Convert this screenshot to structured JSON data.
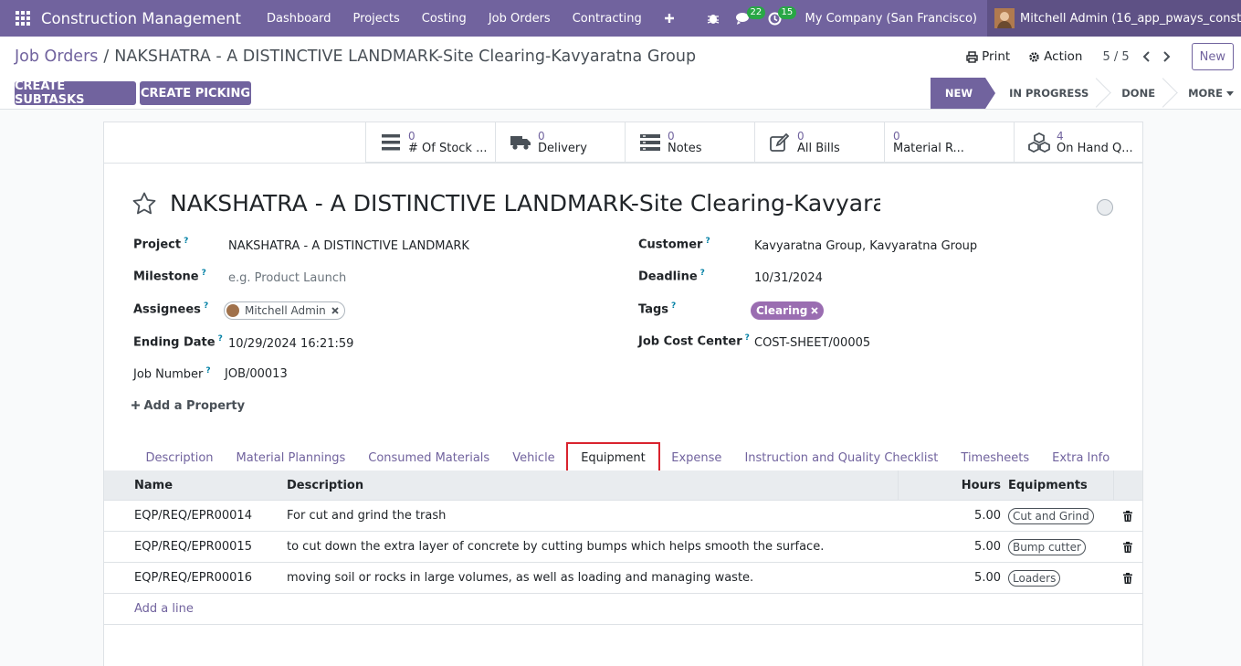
{
  "navbar": {
    "brand": "Construction Management",
    "menu": [
      "Dashboard",
      "Projects",
      "Costing",
      "Job Orders",
      "Contracting"
    ],
    "messages_count": "22",
    "activities_count": "15",
    "company": "My Company (San Francisco)",
    "user": "Mitchell Admin (16_app_pways_const..."
  },
  "control": {
    "breadcrumb_parent": "Job Orders",
    "breadcrumb_sep": "/",
    "breadcrumb_current": "NAKSHATRA - A DISTINCTIVE LANDMARK-Site Clearing-Kavyaratna Group",
    "print_label": "Print",
    "action_label": "Action",
    "pager": "5 / 5",
    "new_label": "New",
    "create_subtasks": "CREATE SUBTASKS",
    "create_picking": "CREATE PICKING",
    "stages": [
      "NEW",
      "IN PROGRESS",
      "DONE"
    ],
    "more": "MORE"
  },
  "smart_buttons": [
    {
      "value": "0",
      "label": "# Of Stock ..."
    },
    {
      "value": "0",
      "label": "Delivery"
    },
    {
      "value": "0",
      "label": "Notes"
    },
    {
      "value": "0",
      "label": "All Bills"
    },
    {
      "value": "0",
      "label": "Material R..."
    },
    {
      "value": "4",
      "label": "On Hand Q..."
    }
  ],
  "record": {
    "title": "NAKSHATRA - A DISTINCTIVE LANDMARK-Site Clearing-Kavyaratna Group",
    "project_label": "Project",
    "project": "NAKSHATRA - A DISTINCTIVE LANDMARK",
    "milestone_label": "Milestone",
    "milestone_placeholder": "e.g. Product Launch",
    "assignees_label": "Assignees",
    "assignee": "Mitchell Admin",
    "ending_date_label": "Ending Date",
    "ending_date": "10/29/2024 16:21:59",
    "job_number_label": "Job Number",
    "job_number": "JOB/00013",
    "customer_label": "Customer",
    "customer": "Kavyaratna Group, Kavyaratna Group",
    "deadline_label": "Deadline",
    "deadline": "10/31/2024",
    "tags_label": "Tags",
    "tag": "Clearing",
    "job_cost_center_label": "Job Cost Center",
    "job_cost_center": "COST-SHEET/00005",
    "add_property": "Add a Property"
  },
  "tabs": [
    "Description",
    "Material Plannings",
    "Consumed Materials",
    "Vehicle",
    "Equipment",
    "Expense",
    "Instruction and Quality Checklist",
    "Timesheets",
    "Extra Info"
  ],
  "table": {
    "headers": {
      "name": "Name",
      "description": "Description",
      "hours": "Hours",
      "equipments": "Equipments"
    },
    "rows": [
      {
        "name": "EQP/REQ/EPR00014",
        "description": "For cut and grind the trash",
        "hours": "5.00",
        "equipment": "Cut and Grind"
      },
      {
        "name": "EQP/REQ/EPR00015",
        "description": "to cut down the extra layer of concrete by cutting bumps which helps smooth the surface.",
        "hours": "5.00",
        "equipment": "Bump cutter"
      },
      {
        "name": "EQP/REQ/EPR00016",
        "description": "moving soil or rocks in large volumes, as well as loading and managing waste.",
        "hours": "5.00",
        "equipment": "Loaders"
      }
    ],
    "add_line": "Add a line"
  },
  "colors": {
    "brand": "#71639e",
    "tab_highlight": "#d9232e",
    "tag": "#9a6db1",
    "counter": "#28a745"
  }
}
